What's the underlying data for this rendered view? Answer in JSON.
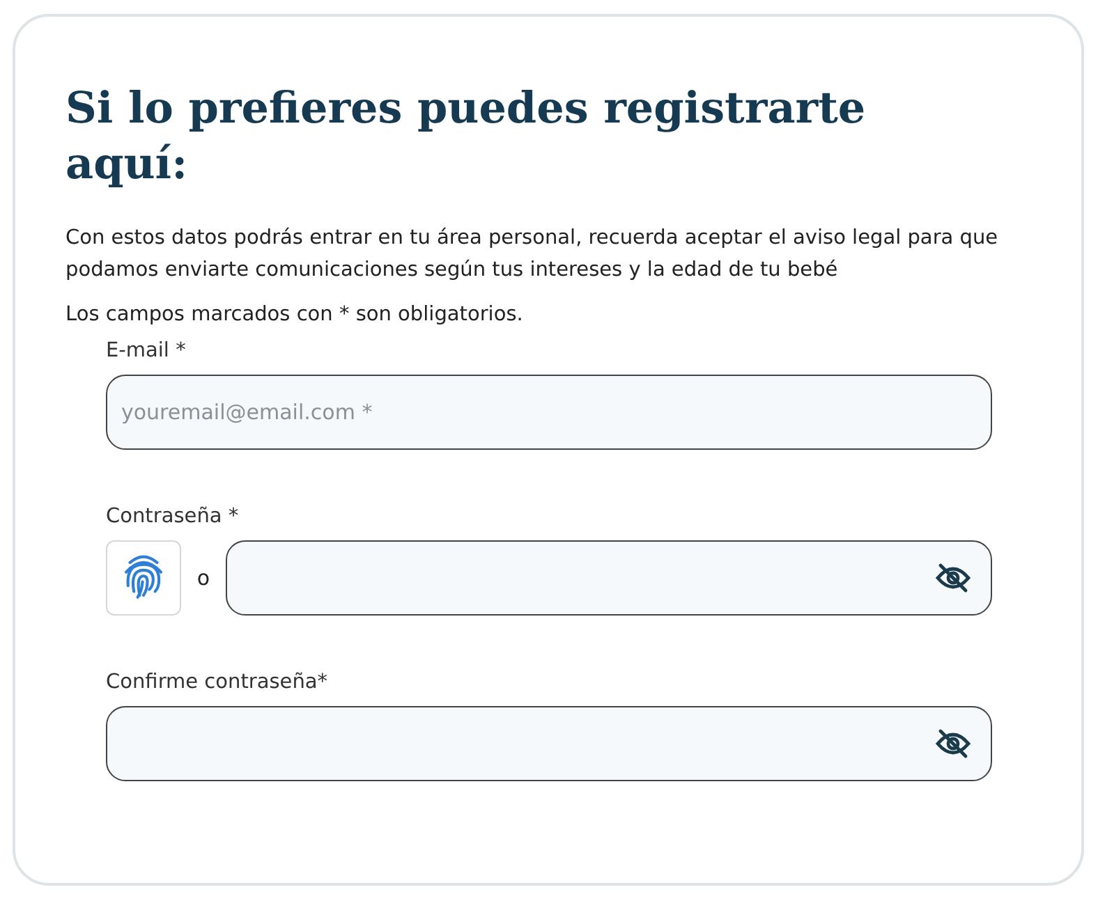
{
  "title": "Si lo prefieres puedes registrarte aquí:",
  "intro": "Con estos datos podrás entrar en tu área personal, recuerda aceptar el aviso legal para que podamos enviarte comunicaciones según tus intereses y la edad de tu bebé",
  "required_note": "Los campos marcados con * son obligatorios.",
  "fields": [
    {
      "kind": "email",
      "label": "E-mail *",
      "placeholder": "youremail@email.com *"
    },
    {
      "kind": "password",
      "label": "Contraseña *",
      "biometric": true,
      "separator": "o"
    },
    {
      "kind": "password",
      "label": "Confirme contraseña*",
      "biometric": false
    }
  ]
}
